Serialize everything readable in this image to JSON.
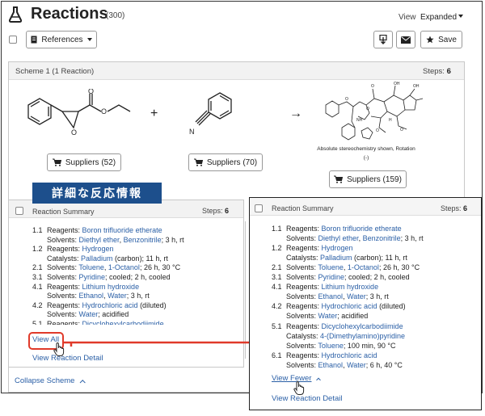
{
  "header": {
    "icon": "flask-icon",
    "title": "Reactions",
    "count": "(300)",
    "view_label": "View",
    "view_value": "Expanded"
  },
  "toolbar": {
    "references_label": "References",
    "save_label": "Save",
    "download_icon": "download-icon",
    "email_icon": "envelope-icon",
    "save_icon": "star-icon"
  },
  "scheme": {
    "title": "Scheme 1  (1 Reaction)",
    "steps_label": "Steps:",
    "steps_value": "6",
    "plus": "+",
    "arrow": "→",
    "nitrile_atom": "N",
    "supplier_buttons": [
      "Suppliers (52)",
      "Suppliers (70)",
      "Suppliers (159)"
    ],
    "stereo_note_line1": "Absolute stereochemistry shown, Rotation",
    "stereo_note_line2": "(-)",
    "collapse_label": "Collapse Scheme"
  },
  "banner": {
    "text": "詳細な反応情報"
  },
  "summary_left": {
    "title": "Reaction Summary",
    "steps_label": "Steps:",
    "steps_value": "6",
    "view_all": "View All",
    "view_detail": "View Reaction Detail",
    "lines": [
      {
        "num": "1.1",
        "parts": [
          [
            "Reagents: ",
            false
          ],
          [
            "Boron trifluoride etherate",
            true
          ]
        ]
      },
      {
        "num": "",
        "parts": [
          [
            "Solvents: ",
            false
          ],
          [
            "Diethyl ether",
            true
          ],
          [
            ",  ",
            false
          ],
          [
            "Benzonitrile",
            true
          ],
          [
            "; 3 h, rt",
            false
          ]
        ]
      },
      {
        "num": "1.2",
        "parts": [
          [
            "Reagents: ",
            false
          ],
          [
            "Hydrogen",
            true
          ]
        ]
      },
      {
        "num": "",
        "parts": [
          [
            "Catalysts: ",
            false
          ],
          [
            "Palladium",
            true
          ],
          [
            " (carbon); 11 h, rt",
            false
          ]
        ]
      },
      {
        "num": "2.1",
        "parts": [
          [
            "Solvents: ",
            false
          ],
          [
            "Toluene",
            true
          ],
          [
            ",  ",
            false
          ],
          [
            "1-Octanol",
            true
          ],
          [
            "; 26 h, 30 °C",
            false
          ]
        ]
      },
      {
        "num": "3.1",
        "parts": [
          [
            "Solvents: ",
            false
          ],
          [
            "Pyridine",
            true
          ],
          [
            "; cooled; 2 h, cooled",
            false
          ]
        ]
      },
      {
        "num": "4.1",
        "parts": [
          [
            "Reagents: ",
            false
          ],
          [
            "Lithium hydroxide",
            true
          ]
        ]
      },
      {
        "num": "",
        "parts": [
          [
            "Solvents: ",
            false
          ],
          [
            "Ethanol",
            true
          ],
          [
            ",  ",
            false
          ],
          [
            "Water",
            true
          ],
          [
            "; 3 h, rt",
            false
          ]
        ]
      },
      {
        "num": "4.2",
        "parts": [
          [
            "Reagents: ",
            false
          ],
          [
            "Hydrochloric acid",
            true
          ],
          [
            " (diluted)",
            false
          ]
        ]
      },
      {
        "num": "",
        "parts": [
          [
            "Solvents: ",
            false
          ],
          [
            "Water",
            true
          ],
          [
            "; acidified",
            false
          ]
        ]
      },
      {
        "num": "5.1",
        "parts": [
          [
            "Reagents: ",
            false
          ],
          [
            "Dicyclohexylcarbodiimide",
            true
          ]
        ]
      }
    ]
  },
  "summary_popup": {
    "title": "Reaction Summary",
    "steps_label": "Steps:",
    "steps_value": "6",
    "view_fewer": "View Fewer",
    "view_detail": "View Reaction Detail",
    "lines": [
      {
        "num": "1.1",
        "parts": [
          [
            "Reagents: ",
            false
          ],
          [
            "Boron trifluoride etherate",
            true
          ]
        ]
      },
      {
        "num": "",
        "parts": [
          [
            "Solvents: ",
            false
          ],
          [
            "Diethyl ether",
            true
          ],
          [
            ",  ",
            false
          ],
          [
            "Benzonitrile",
            true
          ],
          [
            "; 3 h, rt",
            false
          ]
        ]
      },
      {
        "num": "1.2",
        "parts": [
          [
            "Reagents: ",
            false
          ],
          [
            "Hydrogen",
            true
          ]
        ]
      },
      {
        "num": "",
        "parts": [
          [
            "Catalysts: ",
            false
          ],
          [
            "Palladium",
            true
          ],
          [
            " (carbon); 11 h, rt",
            false
          ]
        ]
      },
      {
        "num": "2.1",
        "parts": [
          [
            "Solvents: ",
            false
          ],
          [
            "Toluene",
            true
          ],
          [
            ",  ",
            false
          ],
          [
            "1-Octanol",
            true
          ],
          [
            "; 26 h, 30 °C",
            false
          ]
        ]
      },
      {
        "num": "3.1",
        "parts": [
          [
            "Solvents: ",
            false
          ],
          [
            "Pyridine",
            true
          ],
          [
            "; cooled; 2 h, cooled",
            false
          ]
        ]
      },
      {
        "num": "4.1",
        "parts": [
          [
            "Reagents: ",
            false
          ],
          [
            "Lithium hydroxide",
            true
          ]
        ]
      },
      {
        "num": "",
        "parts": [
          [
            "Solvents: ",
            false
          ],
          [
            "Ethanol",
            true
          ],
          [
            ",  ",
            false
          ],
          [
            "Water",
            true
          ],
          [
            "; 3 h, rt",
            false
          ]
        ]
      },
      {
        "num": "4.2",
        "parts": [
          [
            "Reagents: ",
            false
          ],
          [
            "Hydrochloric acid",
            true
          ],
          [
            " (diluted)",
            false
          ]
        ]
      },
      {
        "num": "",
        "parts": [
          [
            "Solvents: ",
            false
          ],
          [
            "Water",
            true
          ],
          [
            "; acidified",
            false
          ]
        ]
      },
      {
        "num": "5.1",
        "parts": [
          [
            "Reagents: ",
            false
          ],
          [
            "Dicyclohexylcarbodiimide",
            true
          ]
        ]
      },
      {
        "num": "",
        "parts": [
          [
            "Catalysts: ",
            false
          ],
          [
            "4-(Dimethylamino)pyridine",
            true
          ]
        ]
      },
      {
        "num": "",
        "parts": [
          [
            "Solvents: ",
            false
          ],
          [
            "Toluene",
            true
          ],
          [
            "; 100 min, 90 °C",
            false
          ]
        ]
      },
      {
        "num": "6.1",
        "parts": [
          [
            "Reagents: ",
            false
          ],
          [
            "Hydrochloric acid",
            true
          ]
        ]
      },
      {
        "num": "",
        "parts": [
          [
            "Solvents: ",
            false
          ],
          [
            "Ethanol",
            true
          ],
          [
            ",  ",
            false
          ],
          [
            "Water",
            true
          ],
          [
            "; 6 h, 40 °C",
            false
          ]
        ]
      }
    ]
  },
  "colors": {
    "link": "#2a5fa6",
    "banner": "#1d4f8c",
    "highlight": "#e03a2a"
  }
}
